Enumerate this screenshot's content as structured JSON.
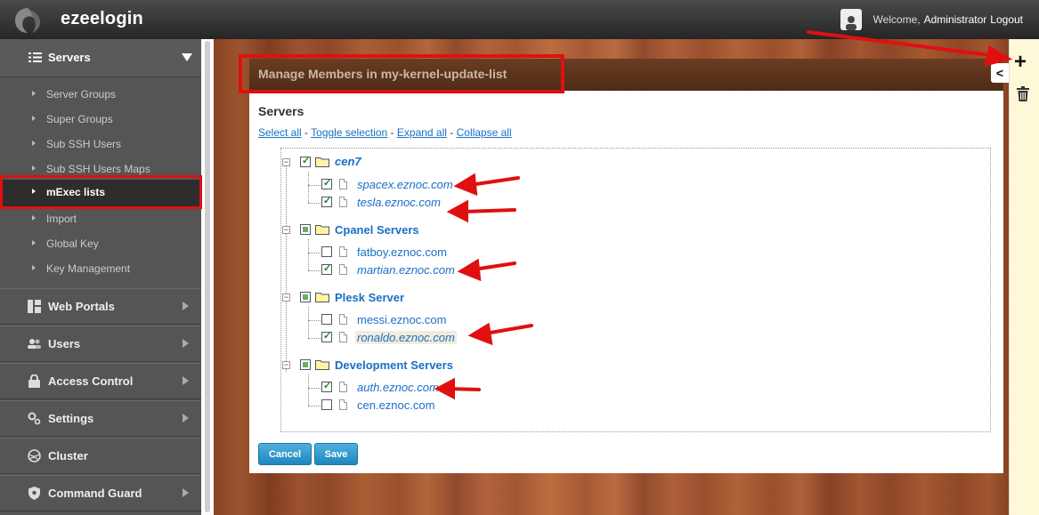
{
  "app": {
    "name": "ezeelogin"
  },
  "topbar": {
    "welcome": "Welcome,",
    "user": "Administrator",
    "logout": "Logout"
  },
  "sidebar": {
    "header": "Servers",
    "sub_items": [
      {
        "label": "Server Groups"
      },
      {
        "label": "Super Groups"
      },
      {
        "label": "Sub SSH Users"
      },
      {
        "label": "Sub SSH Users Maps"
      },
      {
        "label": "mExec lists"
      },
      {
        "label": "Import"
      },
      {
        "label": "Global Key"
      },
      {
        "label": "Key Management"
      }
    ],
    "sections": [
      {
        "label": "Web Portals"
      },
      {
        "label": "Users"
      },
      {
        "label": "Access Control"
      },
      {
        "label": "Settings"
      },
      {
        "label": "Cluster"
      },
      {
        "label": "Command Guard"
      }
    ]
  },
  "panel": {
    "title": "Manage Members in my-kernel-update-list",
    "heading": "Servers",
    "links": {
      "select_all": "Select all",
      "toggle": "Toggle selection",
      "expand": "Expand all",
      "collapse": "Collapse all",
      "sep": " - "
    },
    "groups": [
      {
        "label": "cen7",
        "nodes": [
          {
            "label": "spacex.eznoc.com"
          },
          {
            "label": "tesla.eznoc.com"
          }
        ]
      },
      {
        "label": "Cpanel Servers",
        "nodes": [
          {
            "label": "fatboy.eznoc.com"
          },
          {
            "label": "martian.eznoc.com"
          }
        ]
      },
      {
        "label": "Plesk Server",
        "nodes": [
          {
            "label": "messi.eznoc.com"
          },
          {
            "label": "ronaldo.eznoc.com"
          }
        ]
      },
      {
        "label": "Development Servers",
        "nodes": [
          {
            "label": "auth.eznoc.com"
          },
          {
            "label": "cen.eznoc.com"
          }
        ]
      }
    ],
    "buttons": {
      "cancel": "Cancel",
      "save": "Save"
    }
  },
  "colors": {
    "accent": "#1a6fc4",
    "annotation_red": "#e01010",
    "sidebar": "#555555",
    "button": "#2b95cc"
  }
}
